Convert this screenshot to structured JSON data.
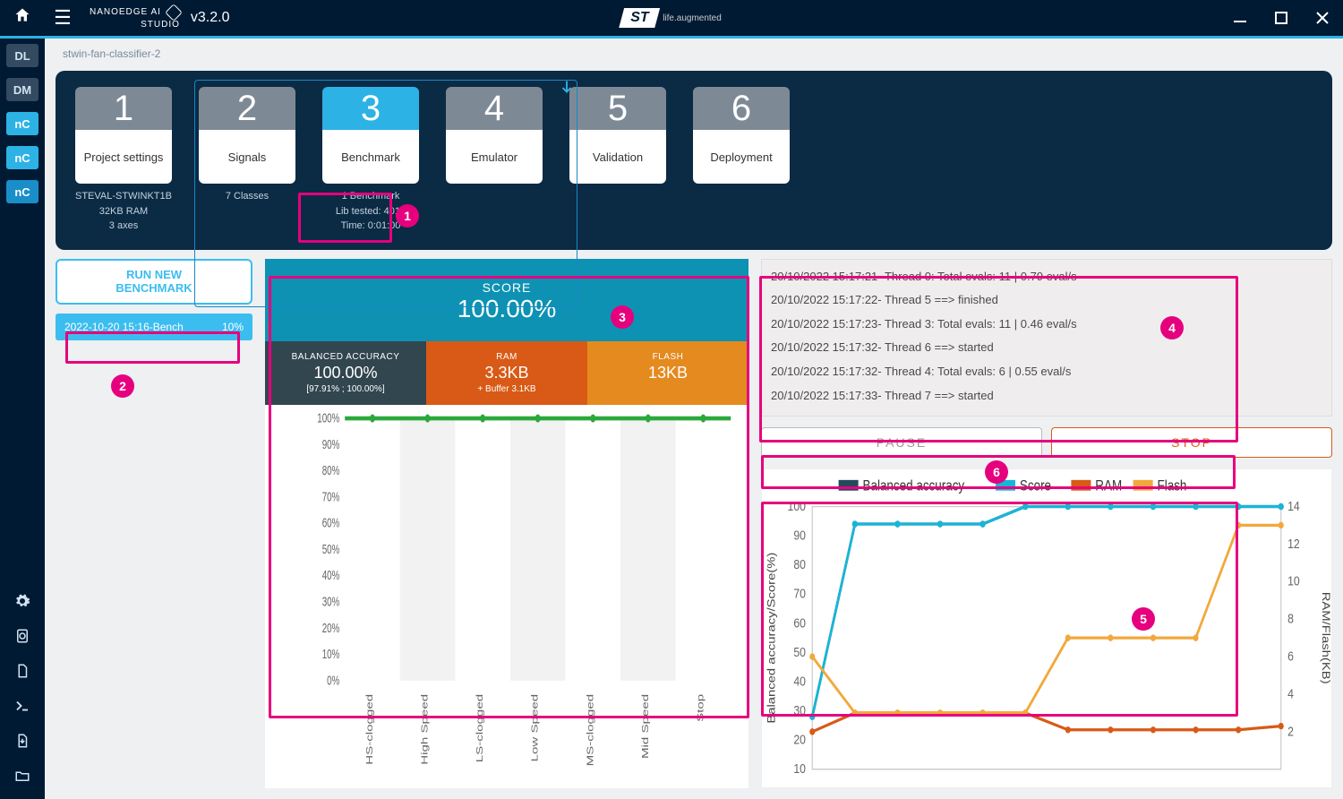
{
  "app": {
    "brand_line1": "NANOEDGE AI",
    "brand_line2": "STUDIO",
    "version": "v3.2.0",
    "logo_text": "ST",
    "logo_tag": "life.augmented"
  },
  "rail": {
    "top": [
      "DL",
      "DM",
      "nC",
      "nC",
      "nC"
    ],
    "bottom_icons": [
      "gear-icon",
      "document-icon",
      "page-icon",
      "terminal-icon",
      "download-icon",
      "folder-icon"
    ]
  },
  "project": {
    "name": "stwin-fan-classifier-2"
  },
  "steps": [
    {
      "num": "1",
      "label": "Project settings",
      "meta": [
        "STEVAL-STWINKT1B",
        "32KB RAM",
        "3 axes"
      ],
      "active": false
    },
    {
      "num": "2",
      "label": "Signals",
      "meta": [
        "7 Classes"
      ],
      "active": false
    },
    {
      "num": "3",
      "label": "Benchmark",
      "meta": [
        "1 Benchmark",
        "Lib tested: 4018",
        "Time: 0:01:00"
      ],
      "active": true
    },
    {
      "num": "4",
      "label": "Emulator",
      "meta": [],
      "active": false
    },
    {
      "num": "5",
      "label": "Validation",
      "meta": [],
      "active": false
    },
    {
      "num": "6",
      "label": "Deployment",
      "meta": [],
      "active": false
    }
  ],
  "left": {
    "run_btn_line1": "RUN NEW",
    "run_btn_line2": "BENCHMARK",
    "bench_item_label": "2022-10-20 15:16-Bench",
    "bench_item_pct": "10%",
    "spinner_char": "("
  },
  "score": {
    "label": "SCORE",
    "value": "100.00%"
  },
  "metrics": {
    "ba": {
      "title": "BALANCED ACCURACY",
      "value": "100.00%",
      "sub": "[97.91% ; 100.00%]"
    },
    "ram": {
      "title": "RAM",
      "value": "3.3KB",
      "sub": "+ Buffer 3.1KB"
    },
    "flash": {
      "title": "FLASH",
      "value": "13KB",
      "sub": ""
    }
  },
  "log_lines": [
    "20/10/2022 15:17:21- Thread 0: Total evals: 11 | 0.79 eval/s",
    "20/10/2022 15:17:22- Thread 5 ==> finished",
    "20/10/2022 15:17:23- Thread 3: Total evals: 11 | 0.46 eval/s",
    "20/10/2022 15:17:32- Thread 6 ==> started",
    "20/10/2022 15:17:32- Thread 4: Total evals: 6 | 0.55 eval/s",
    "20/10/2022 15:17:33- Thread 7 ==> started"
  ],
  "controls": {
    "pause": "PAUSE",
    "stop": "STOP"
  },
  "chart_data": [
    {
      "type": "bar",
      "title": "",
      "categories": [
        "HS-clogged",
        "High Speed",
        "LS-clogged",
        "Low Speed",
        "MS-clogged",
        "Mid Speed",
        "Stop"
      ],
      "values": [
        100,
        100,
        100,
        100,
        100,
        100,
        100
      ],
      "ylabel": "",
      "xlabel": "",
      "ylim": [
        0,
        100
      ],
      "yticks": [
        "0%",
        "10%",
        "20%",
        "30%",
        "40%",
        "50%",
        "60%",
        "70%",
        "80%",
        "90%",
        "100%"
      ]
    },
    {
      "type": "line",
      "title": "",
      "x": [
        1,
        2,
        3,
        4,
        5,
        6,
        7,
        8,
        9,
        10,
        11,
        12
      ],
      "series": [
        {
          "name": "Balanced accuracy",
          "color": "#254a5c",
          "axis": "left",
          "values": [
            28,
            94,
            94,
            94,
            94,
            100,
            100,
            100,
            100,
            100,
            100,
            100
          ]
        },
        {
          "name": "Score",
          "color": "#17b6d8",
          "axis": "left",
          "values": [
            28,
            94,
            94,
            94,
            94,
            100,
            100,
            100,
            100,
            100,
            100,
            100
          ]
        },
        {
          "name": "RAM",
          "color": "#d85a16",
          "axis": "right",
          "values": [
            2,
            3,
            3,
            3,
            3,
            3,
            2.1,
            2.1,
            2.1,
            2.1,
            2.1,
            2.3
          ]
        },
        {
          "name": "Flash",
          "color": "#f2a83b",
          "axis": "right",
          "values": [
            6,
            3,
            3,
            3,
            3,
            3,
            7,
            7,
            7,
            7,
            13,
            13
          ]
        }
      ],
      "ylabel_left": "Balanced accuracy/Score(%)",
      "ylabel_right": "RAM/Flash(KB)",
      "ylim_left": [
        10,
        100
      ],
      "ylim_right": [
        0,
        14
      ],
      "yticks_left": [
        10,
        20,
        30,
        40,
        50,
        60,
        70,
        80,
        90,
        100
      ],
      "yticks_right": [
        2,
        4,
        6,
        8,
        10,
        12,
        14
      ],
      "legend": [
        "Balanced accuracy",
        "Score",
        "RAM",
        "Flash"
      ]
    }
  ],
  "annotations": [
    1,
    2,
    3,
    4,
    5,
    6
  ]
}
